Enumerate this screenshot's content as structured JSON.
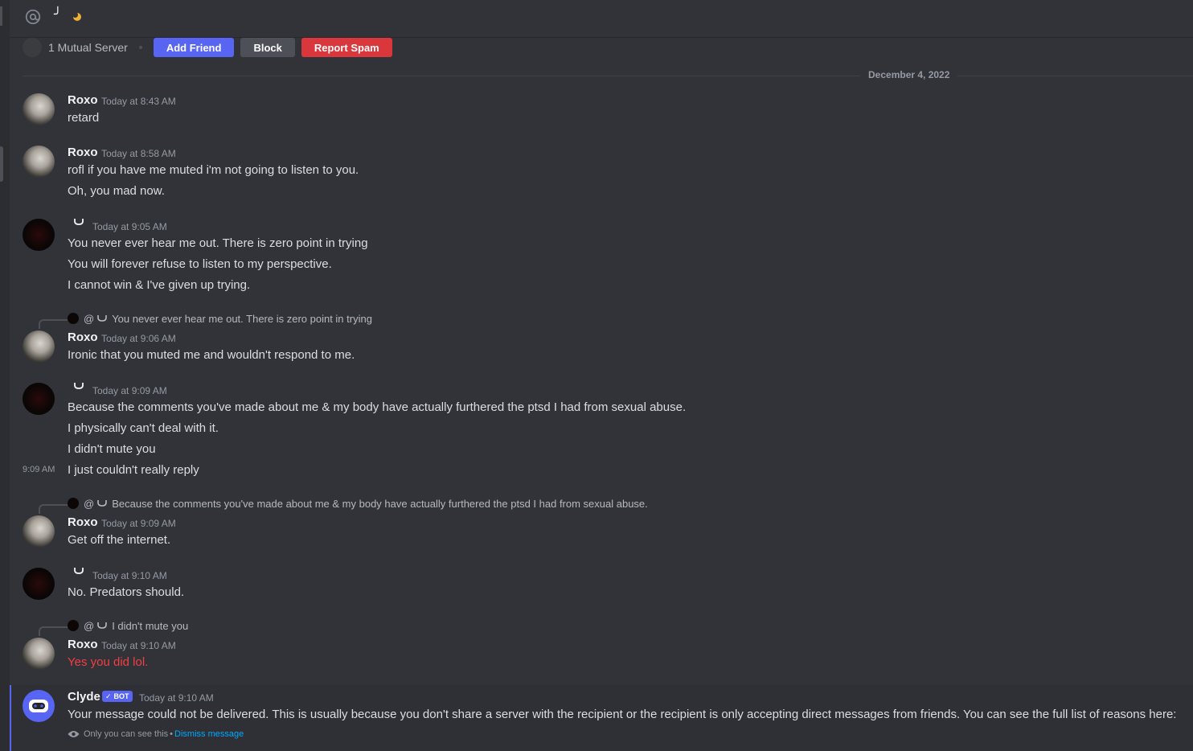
{
  "header": {
    "username_glyph": "╯",
    "status": "idle"
  },
  "profile_bar": {
    "mutual": "1 Mutual Server",
    "add_friend": "Add Friend",
    "block": "Block",
    "report_spam": "Report Spam"
  },
  "date_divider": "December 4, 2022",
  "messages": [
    {
      "author": "Roxo",
      "time": "Today at 8:43 AM",
      "lines": [
        "retard"
      ]
    },
    {
      "author": "Roxo",
      "time": "Today at 8:58 AM",
      "lines": [
        "rofl if you have me muted i'm not going to listen to you.",
        "Oh, you mad now."
      ]
    },
    {
      "author": "",
      "time": "Today at 9:05 AM",
      "lines": [
        "You never ever hear me out. There is zero point in trying",
        "You will forever refuse to listen to my perspective.",
        "I cannot win & I've given up trying."
      ]
    },
    {
      "reply": "You never ever hear me out. There is zero point in trying",
      "author": "Roxo",
      "time": "Today at 9:06 AM",
      "lines": [
        "Ironic that you muted me and wouldn't respond to me."
      ]
    },
    {
      "author": "",
      "time": "Today at 9:09 AM",
      "lines": [
        "Because the comments you've made about me & my body have actually furthered the ptsd I had from sexual abuse.",
        "I physically can't deal with it.",
        "I didn't mute you",
        "I just couldn't really reply"
      ],
      "hover_time": "9:09 AM"
    },
    {
      "reply": "Because the comments you've made about me & my body have actually furthered the ptsd I had from sexual abuse.",
      "author": "Roxo",
      "time": "Today at 9:09 AM",
      "lines": [
        "Get off the internet."
      ]
    },
    {
      "author": "",
      "time": "Today at 9:10 AM",
      "lines": [
        "No. Predators should."
      ]
    },
    {
      "reply": "I didn't mute you",
      "author": "Roxo",
      "time": "Today at 9:10 AM",
      "lines": [
        "Yes you did lol."
      ]
    }
  ],
  "clyde": {
    "author": "Clyde",
    "badge": "BOT",
    "time": "Today at 9:10 AM",
    "text": "Your message could not be delivered. This is usually because you don't share a server with the recipient or the recipient is only accepting direct messages from friends. You can see the full list of reasons here:",
    "only_you": "Only you can see this",
    "separator": "•",
    "dismiss": "Dismiss message"
  },
  "colors": {
    "accent": "#5865f2",
    "danger": "#da373c",
    "background": "#313338",
    "red_text": "#f23f43",
    "link": "#00a8fc"
  }
}
